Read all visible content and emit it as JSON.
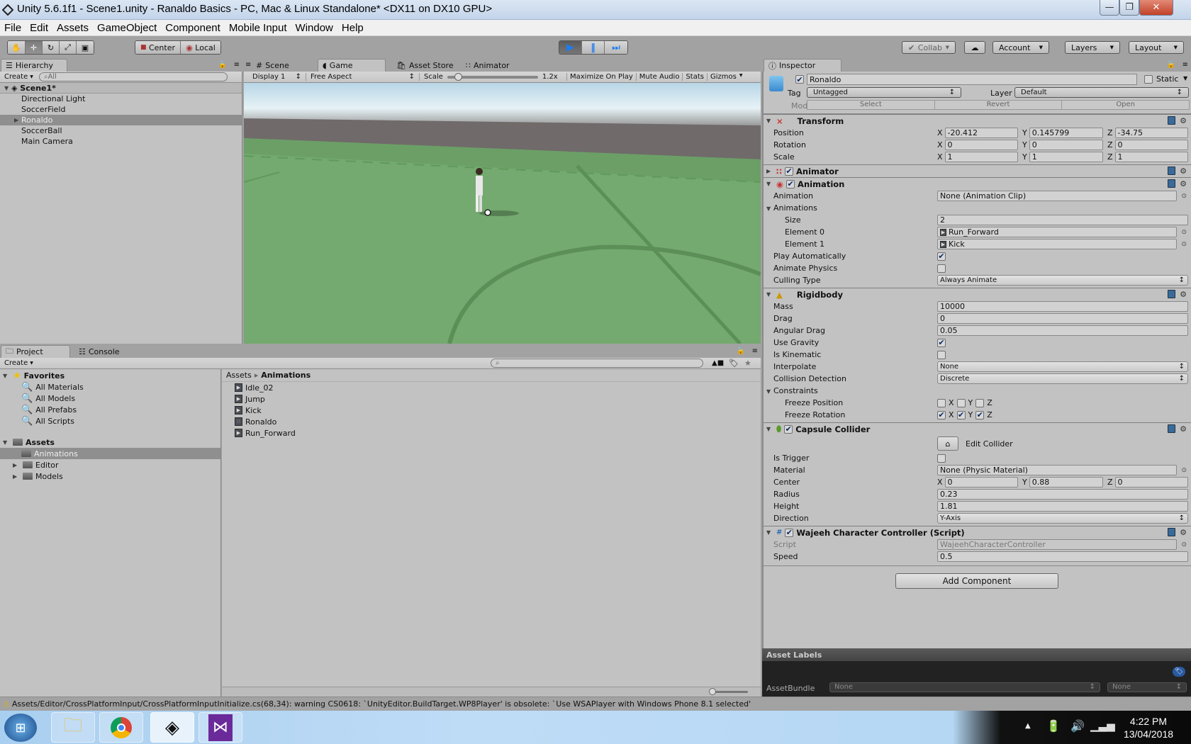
{
  "window": {
    "title": "Unity 5.6.1f1 - Scene1.unity - Ranaldo Basics - PC, Mac & Linux Standalone* <DX11 on DX10 GPU>",
    "controls": [
      "minimize",
      "maximize",
      "close"
    ]
  },
  "menu": [
    "File",
    "Edit",
    "Assets",
    "GameObject",
    "Component",
    "Mobile Input",
    "Window",
    "Help"
  ],
  "toolbar": {
    "tools": [
      "hand-tool",
      "move-tool",
      "rotate-tool",
      "scale-tool",
      "rect-tool"
    ],
    "active_tool": "move-tool",
    "pivot": "Center",
    "space": "Local",
    "play_active": true,
    "collab": "Collab",
    "account": "Account",
    "layers": "Layers",
    "layout": "Layout"
  },
  "hierarchy": {
    "tab": "Hierarchy",
    "create": "Create",
    "search_placeholder": "All",
    "scene": "Scene1*",
    "items": [
      {
        "label": "Directional Light",
        "selected": false,
        "expandable": false
      },
      {
        "label": "SoccerField",
        "selected": false,
        "expandable": false
      },
      {
        "label": "Ronaldo",
        "selected": true,
        "expandable": true
      },
      {
        "label": "SoccerBall",
        "selected": false,
        "expandable": false
      },
      {
        "label": "Main Camera",
        "selected": false,
        "expandable": false
      }
    ]
  },
  "center_tabs": [
    {
      "label": "Scene",
      "active": false
    },
    {
      "label": "Game",
      "active": true
    },
    {
      "label": "Asset Store",
      "active": false
    },
    {
      "label": "Animator",
      "active": false
    }
  ],
  "game_toolbar": {
    "display": "Display 1",
    "aspect": "Free Aspect",
    "scale_label": "Scale",
    "scale_value": "1.2x",
    "maximize": "Maximize On Play",
    "mute": "Mute Audio",
    "stats": "Stats",
    "gizmos": "Gizmos"
  },
  "project": {
    "tabs": [
      "Project",
      "Console"
    ],
    "create": "Create",
    "favorites_label": "Favorites",
    "favorites": [
      "All Materials",
      "All Models",
      "All Prefabs",
      "All Scripts"
    ],
    "assets_label": "Assets",
    "folders": [
      {
        "label": "Animations",
        "selected": true,
        "expandable": false
      },
      {
        "label": "Editor",
        "selected": false,
        "expandable": true
      },
      {
        "label": "Models",
        "selected": false,
        "expandable": true
      }
    ],
    "breadcrumb": [
      "Assets",
      "Animations"
    ],
    "files": [
      {
        "label": "Idle_02",
        "type": "animation-clip"
      },
      {
        "label": "Jump",
        "type": "animation-clip"
      },
      {
        "label": "Kick",
        "type": "animation-clip"
      },
      {
        "label": "Ronaldo",
        "type": "animator-controller"
      },
      {
        "label": "Run_Forward",
        "type": "animation-clip"
      }
    ]
  },
  "inspector": {
    "tab": "Inspector",
    "object_name": "Ronaldo",
    "active": true,
    "static_label": "Static",
    "tag_label": "Tag",
    "tag": "Untagged",
    "layer_label": "Layer",
    "layer": "Default",
    "model_label": "Model",
    "model_buttons": [
      "Select",
      "Revert",
      "Open"
    ],
    "transform": {
      "title": "Transform",
      "position_label": "Position",
      "position": {
        "x": "-20.412",
        "y": "0.145799",
        "z": "-34.75"
      },
      "rotation_label": "Rotation",
      "rotation": {
        "x": "0",
        "y": "0",
        "z": "0"
      },
      "scale_label": "Scale",
      "scale": {
        "x": "1",
        "y": "1",
        "z": "1"
      }
    },
    "animator": {
      "title": "Animator",
      "enabled": true
    },
    "animation": {
      "title": "Animation",
      "enabled": true,
      "animation_label": "Animation",
      "animation": "None (Animation Clip)",
      "animations_label": "Animations",
      "size_label": "Size",
      "size": "2",
      "elements": [
        {
          "label": "Element 0",
          "value": "Run_Forward"
        },
        {
          "label": "Element 1",
          "value": "Kick"
        }
      ],
      "play_auto_label": "Play Automatically",
      "play_auto": true,
      "animate_physics_label": "Animate Physics",
      "animate_physics": false,
      "culling_label": "Culling Type",
      "culling": "Always Animate"
    },
    "rigidbody": {
      "title": "Rigidbody",
      "mass_label": "Mass",
      "mass": "10000",
      "drag_label": "Drag",
      "drag": "0",
      "angular_drag_label": "Angular Drag",
      "angular_drag": "0.05",
      "use_gravity_label": "Use Gravity",
      "use_gravity": true,
      "is_kinematic_label": "Is Kinematic",
      "is_kinematic": false,
      "interpolate_label": "Interpolate",
      "interpolate": "None",
      "collision_label": "Collision Detection",
      "collision": "Discrete",
      "constraints_label": "Constraints",
      "freeze_position_label": "Freeze Position",
      "freeze_position": {
        "x": false,
        "y": false,
        "z": false
      },
      "freeze_rotation_label": "Freeze Rotation",
      "freeze_rotation": {
        "x": true,
        "y": true,
        "z": true
      }
    },
    "capsule": {
      "title": "Capsule Collider",
      "enabled": true,
      "edit_label": "Edit Collider",
      "is_trigger_label": "Is Trigger",
      "is_trigger": false,
      "material_label": "Material",
      "material": "None (Physic Material)",
      "center_label": "Center",
      "center": {
        "x": "0",
        "y": "0.88",
        "z": "0"
      },
      "radius_label": "Radius",
      "radius": "0.23",
      "height_label": "Height",
      "height": "1.81",
      "direction_label": "Direction",
      "direction": "Y-Axis"
    },
    "script": {
      "title": "Wajeeh Character Controller (Script)",
      "enabled": true,
      "script_label": "Script",
      "script": "WajeehCharacterController",
      "speed_label": "Speed",
      "speed": "0.5"
    },
    "add_component": "Add Component",
    "asset_labels": "Asset Labels",
    "assetbundle_label": "AssetBundle",
    "assetbundle": "None",
    "assetbundle_variant": "None"
  },
  "status": {
    "message": "Assets/Editor/CrossPlatformInput/CrossPlatformInputInitialize.cs(68,34): warning CS0618: `UnityEditor.BuildTarget.WP8Player' is obsolete: `Use WSAPlayer with Windows Phone 8.1 selected'"
  },
  "taskbar": {
    "apps": [
      "start-button",
      "file-explorer",
      "chrome",
      "unity",
      "visual-studio"
    ],
    "time": "4:22 PM",
    "date": "13/04/2018"
  },
  "colors": {
    "play_blue": "#1e7cf0",
    "selection": "#8f8f8f",
    "panel": "#c2c2c2",
    "grass": "#74a96f"
  }
}
